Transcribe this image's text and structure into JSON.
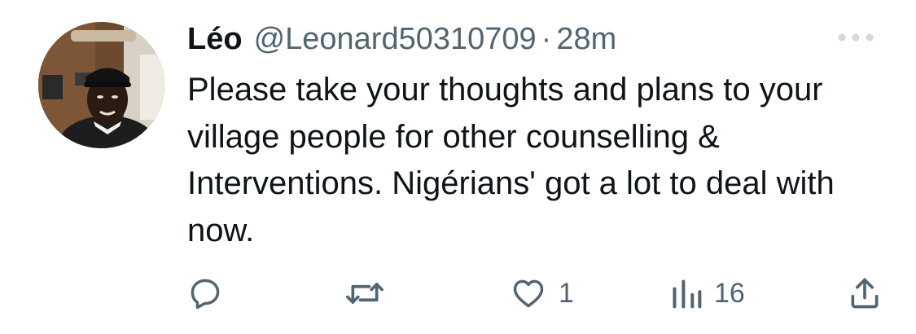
{
  "tweet": {
    "author": {
      "display_name": "Léo",
      "handle": "@Leonard50310709"
    },
    "separator": "·",
    "time": "28m",
    "text": "Please take your thoughts and plans to your village people for other counselling & Interventions. Nigérians' got a lot to deal with now.",
    "actions": {
      "reply": {
        "icon": "reply-icon",
        "count": ""
      },
      "retweet": {
        "icon": "retweet-icon",
        "count": ""
      },
      "like": {
        "icon": "heart-icon",
        "count": "1"
      },
      "views": {
        "icon": "views-icon",
        "count": "16"
      },
      "share": {
        "icon": "share-icon",
        "count": ""
      }
    },
    "more_icon": "more-dots-icon"
  },
  "colors": {
    "text_primary": "#0f1419",
    "text_secondary": "#536471",
    "background": "#ffffff"
  }
}
